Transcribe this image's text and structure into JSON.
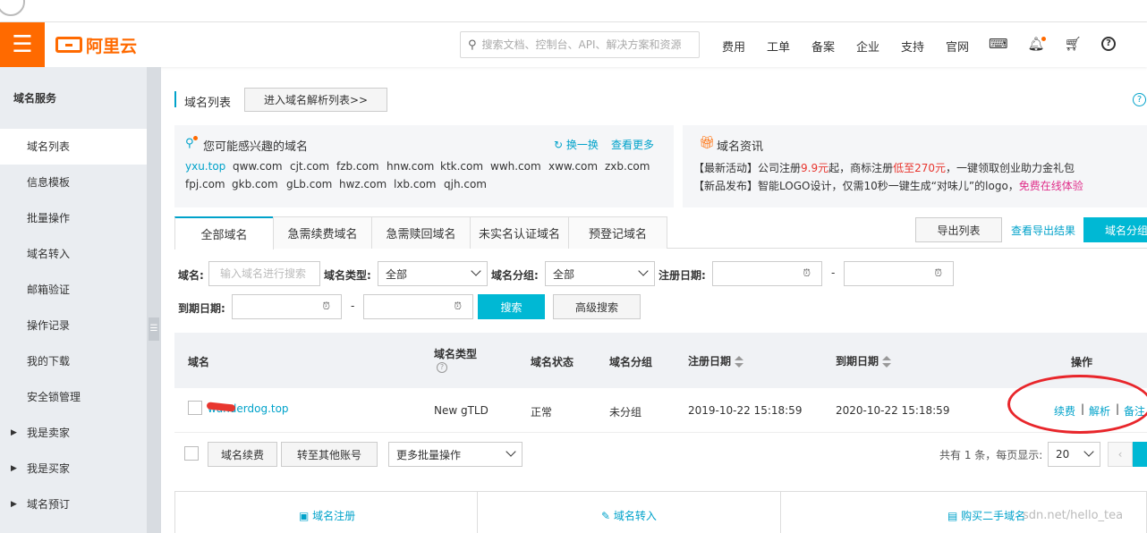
{
  "header": {
    "logo_text": "阿里云",
    "search_placeholder": "搜索文档、控制台、API、解决方案和资源",
    "nav": [
      "费用",
      "工单",
      "备案",
      "企业",
      "支持",
      "官网"
    ],
    "icons": [
      "terminal-icon",
      "bell-icon",
      "cart-icon",
      "help-icon"
    ]
  },
  "sidebar": {
    "title": "域名服务",
    "items": [
      {
        "label": "域名列表",
        "active": true
      },
      {
        "label": "信息模板"
      },
      {
        "label": "批量操作"
      },
      {
        "label": "域名转入"
      },
      {
        "label": "邮箱验证"
      },
      {
        "label": "操作记录"
      },
      {
        "label": "我的下载"
      },
      {
        "label": "安全锁管理"
      },
      {
        "label": "我是卖家",
        "expandable": true
      },
      {
        "label": "我是买家",
        "expandable": true
      },
      {
        "label": "域名预订",
        "expandable": true
      }
    ]
  },
  "section": {
    "title": "域名列表",
    "enter_dns": "进入域名解析列表>>",
    "help": "?"
  },
  "interest": {
    "title": "您可能感兴趣的域名",
    "swap": "换一换",
    "more": "查看更多",
    "row1": [
      "yxu.top",
      "qww.com",
      "cjt.com",
      "fzb.com",
      "hnw.com",
      "ktk.com",
      "wwh.com",
      "xww.com",
      "zxb.com"
    ],
    "row2": [
      "fpj.com",
      "gkb.com",
      "gLb.com",
      "hwz.com",
      "lxb.com",
      "qjh.com"
    ]
  },
  "news": {
    "title": "域名资讯",
    "line1": {
      "a": "【最新活动】公司注册",
      "b": "9.9元",
      "c": "起，商标注册",
      "d": "低至270元",
      "e": "，一键领取创业助力金礼包"
    },
    "line2": {
      "a": "【新品发布】智能LOGO设计，仅需10秒一键生成“对味儿”的logo，",
      "b": "免费在线体验"
    }
  },
  "tabs": [
    "全部域名",
    "急需续费域名",
    "急需赎回域名",
    "未实名认证域名",
    "预登记域名"
  ],
  "toolbar": {
    "export": "导出列表",
    "export_result": "查看导出结果",
    "group": "域名分组"
  },
  "filters": {
    "domain_label": "域名:",
    "domain_placeholder": "输入域名进行搜索",
    "type_label": "域名类型:",
    "type_value": "全部",
    "group_label": "域名分组:",
    "group_value": "全部",
    "reg_label": "注册日期:",
    "exp_label": "到期日期:",
    "dash": "-",
    "search": "搜索",
    "advanced": "高级搜索"
  },
  "table": {
    "headers": {
      "domain": "域名",
      "type": "域名类型",
      "status": "域名状态",
      "group": "域名分组",
      "reg": "注册日期",
      "exp": "到期日期",
      "ops": "操作"
    },
    "rows": [
      {
        "domain": "wanderdog.top",
        "type": "New gTLD",
        "status": "正常",
        "group": "未分组",
        "reg": "2019-10-22 15:18:59",
        "exp": "2020-10-22 15:18:59",
        "ops": [
          "续费",
          "解析",
          "备注"
        ]
      }
    ],
    "sep": "|"
  },
  "batch": {
    "renew": "域名续费",
    "transfer": "转至其他账号",
    "more_ops": "更多批量操作",
    "total": "共有 1 条，每页显示:",
    "page_size": "20",
    "prev": "‹"
  },
  "bottom": {
    "register": "域名注册",
    "transfer_in": "域名转入",
    "buy_second": "购买二手域名"
  },
  "watermark": "sdn.net/hello_tea"
}
